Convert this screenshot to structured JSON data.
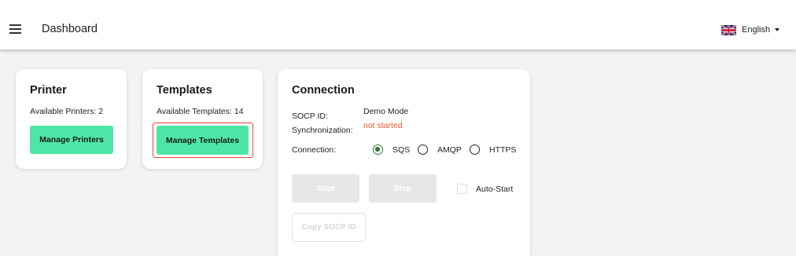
{
  "header": {
    "title": "Dashboard",
    "language_label": "English",
    "menu_icon": "hamburger-menu-icon",
    "flag_icon": "uk-flag-icon"
  },
  "printer_card": {
    "title": "Printer",
    "available_text": "Available Printers: 2",
    "button_label": "Manage Printers"
  },
  "templates_card": {
    "title": "Templates",
    "available_text": "Available Templates: 14",
    "button_label": "Manage Templates"
  },
  "connection_card": {
    "title": "Connection",
    "socp_id_label": "SOCP ID:",
    "socp_id_value": "Demo Mode",
    "sync_label": "Synchronization:",
    "sync_value": "not started",
    "connection_label": "Connection:",
    "options": [
      "SQS",
      "AMQP",
      "HTTPS"
    ],
    "selected_option": "SQS",
    "start_label": "Start",
    "stop_label": "Stop",
    "auto_start_label": "Auto-Start",
    "auto_start_checked": false,
    "copy_label": "Copy SOCP ID"
  },
  "colors": {
    "accent_green": "#4ee6a6",
    "radio_selected": "#2e7d32",
    "status_red": "#f0532c",
    "highlight_red": "#e0473a"
  }
}
